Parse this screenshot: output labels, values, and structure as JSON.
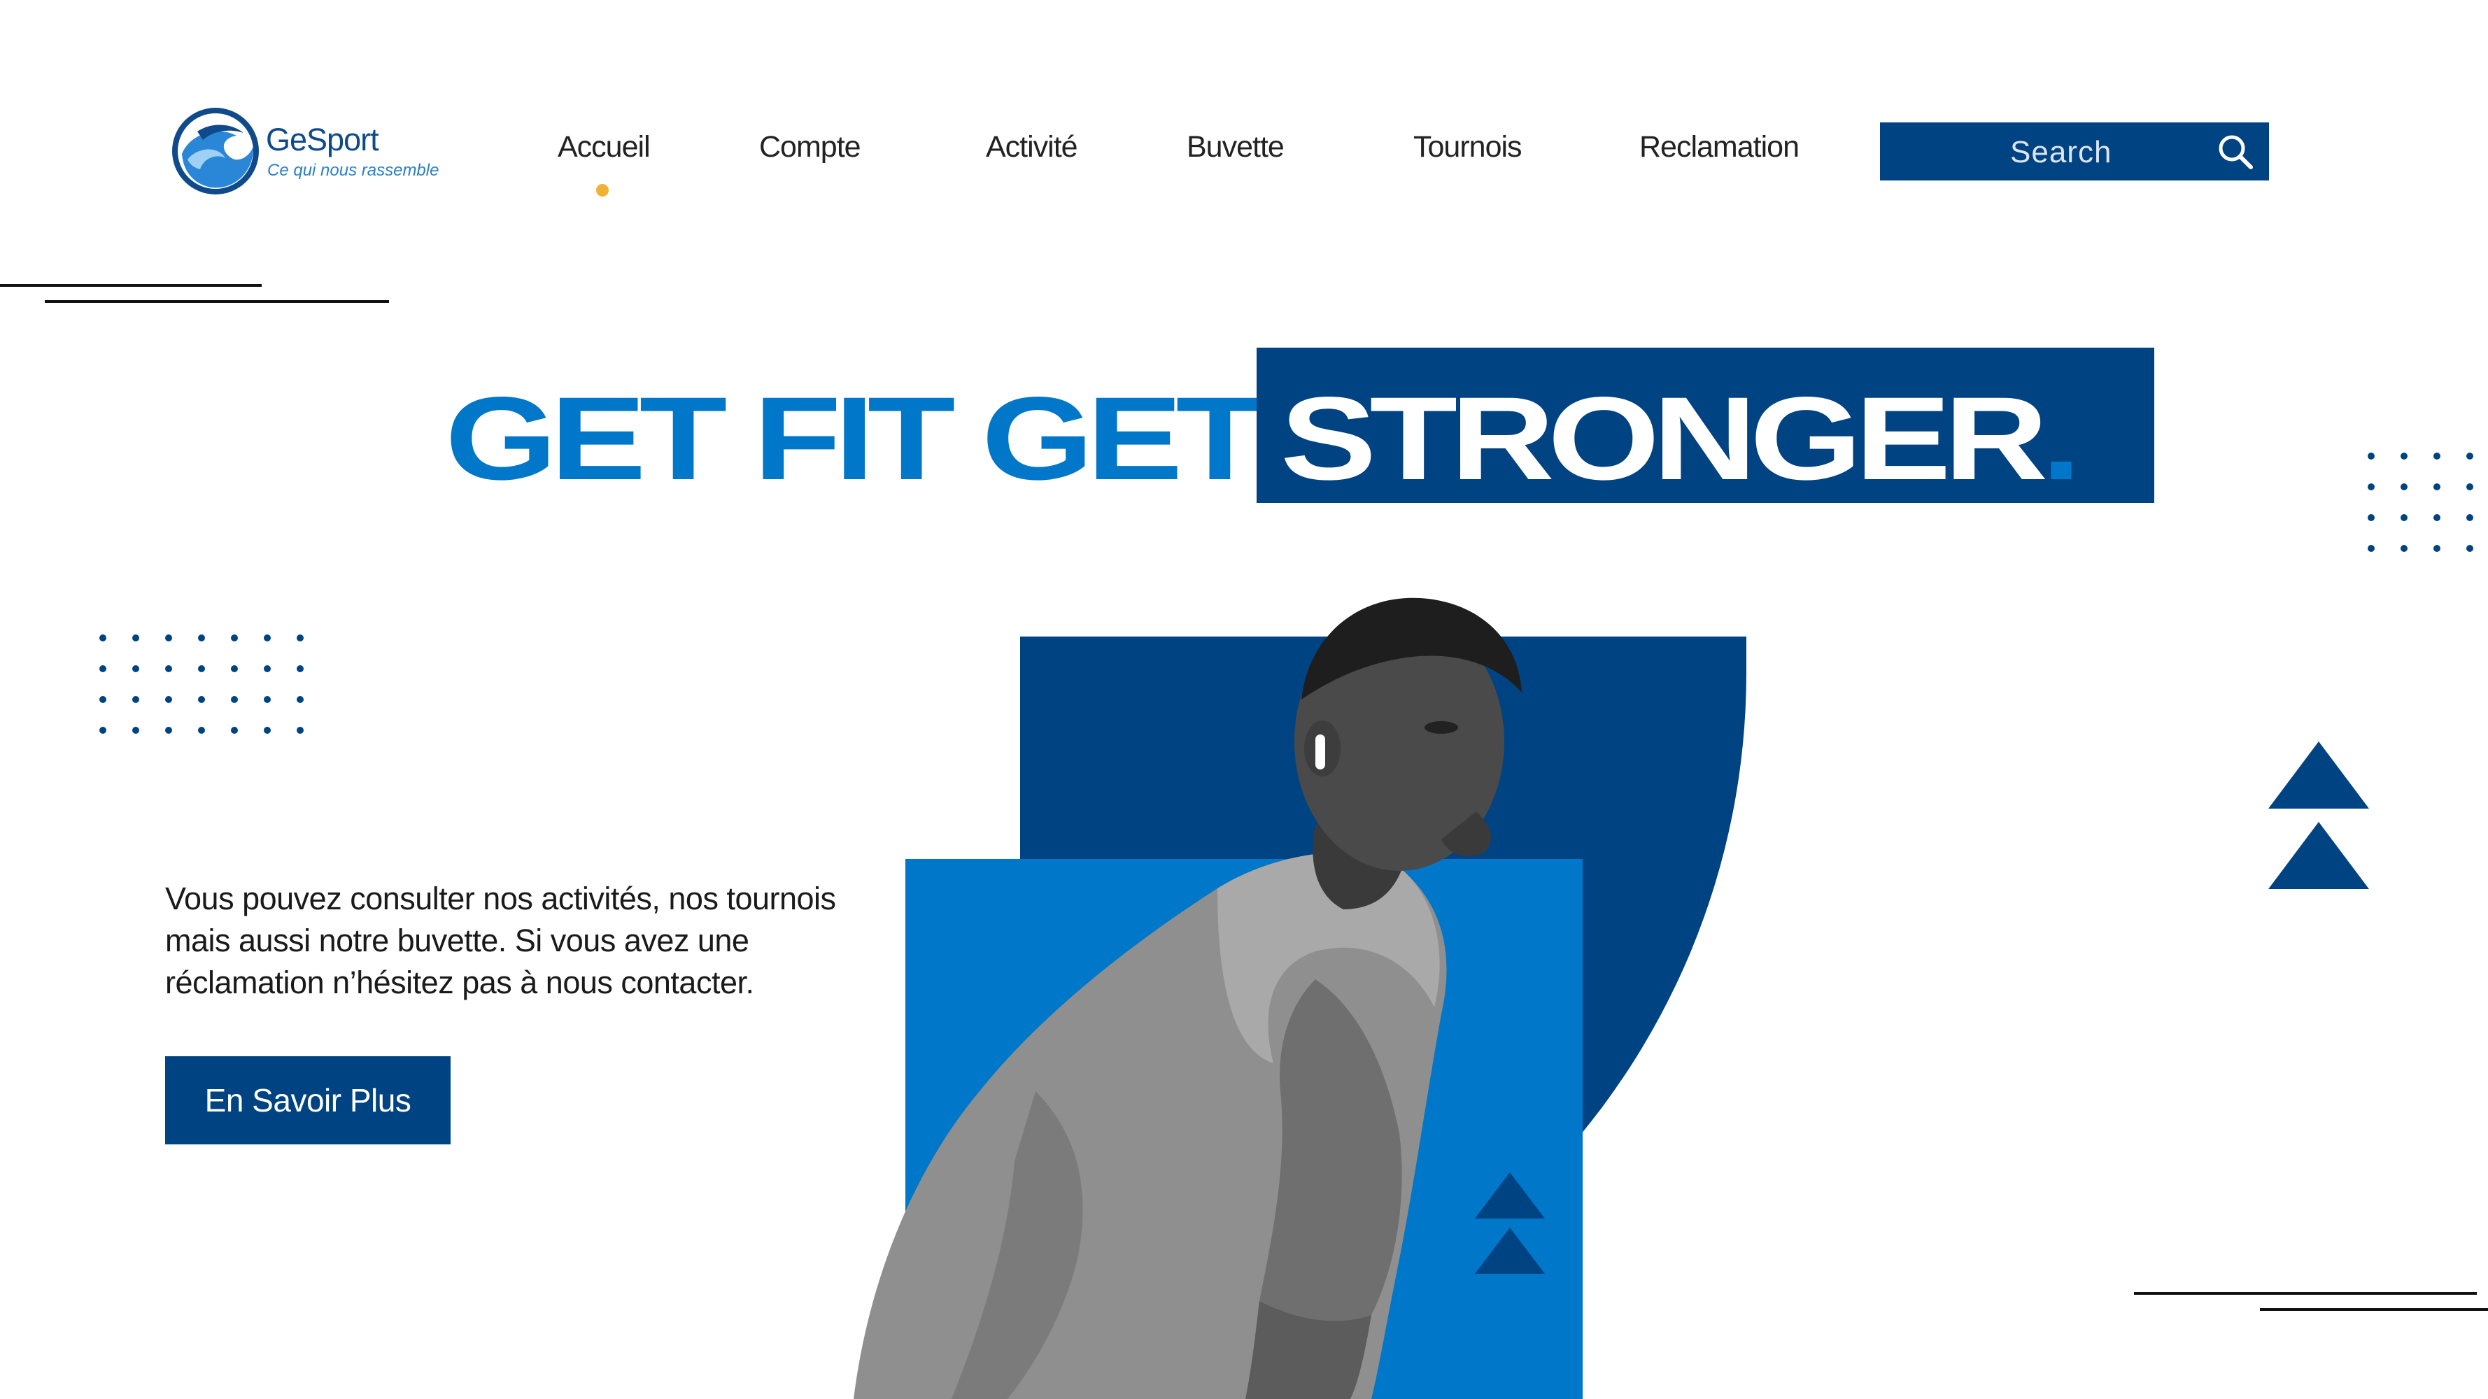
{
  "brand": {
    "name": "GeSport",
    "tagline": "Ce qui nous rassemble",
    "logo_icon": "wave-logo-icon"
  },
  "nav": {
    "items": [
      {
        "label": "Accueil",
        "active": true
      },
      {
        "label": "Compte"
      },
      {
        "label": "Activité"
      },
      {
        "label": "Buvette"
      },
      {
        "label": "Tournois"
      },
      {
        "label": "Reclamation"
      }
    ],
    "active_indicator_color": "#f2b134"
  },
  "search": {
    "placeholder": "Search",
    "icon": "search-icon"
  },
  "hero": {
    "headline_part1": "GET FIT GET",
    "headline_part2": "STRONGER",
    "headline_punct": ".",
    "description": "Vous pouvez consulter nos activités, nos tournois mais aussi notre buvette. Si vous avez une réclamation n’hésitez pas à nous contacter.",
    "cta_label": "En Savoir Plus"
  },
  "colors": {
    "primary_dark": "#004382",
    "primary_light": "#0077c8",
    "accent": "#f2b134"
  }
}
